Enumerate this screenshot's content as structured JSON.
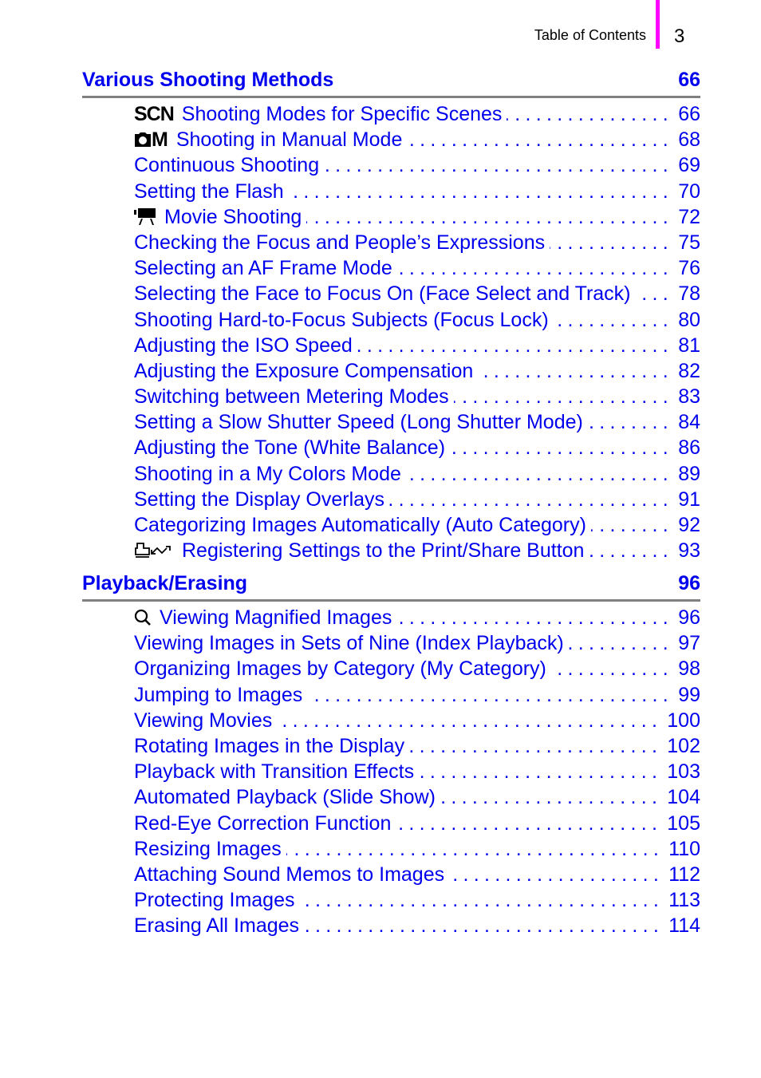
{
  "header": {
    "title": "Table of Contents",
    "page_number": "3",
    "accent_color": "#ff00ff"
  },
  "link_color": "#0000ee",
  "sections": [
    {
      "title": "Various Shooting Methods",
      "page": "66",
      "entries": [
        {
          "icon": "scn-mode-icon",
          "icon_text": "SCN",
          "title": "Shooting Modes for Specific Scenes",
          "page": "66"
        },
        {
          "icon": "camera-manual-icon",
          "icon_text": "M",
          "title": "Shooting in Manual Mode",
          "page": "68"
        },
        {
          "title": "Continuous Shooting",
          "page": "69"
        },
        {
          "title": "Setting the Flash",
          "page": "70"
        },
        {
          "icon": "movie-camera-icon",
          "title": "Movie Shooting",
          "page": "72"
        },
        {
          "title": "Checking the Focus and People’s Expressions",
          "page": "75"
        },
        {
          "title": "Selecting an AF Frame Mode",
          "page": "76"
        },
        {
          "title": "Selecting the Face to Focus On (Face Select and Track)",
          "page": "78"
        },
        {
          "title": "Shooting Hard-to-Focus Subjects (Focus Lock)",
          "page": "80"
        },
        {
          "title": "Adjusting the ISO Speed",
          "page": "81"
        },
        {
          "title": "Adjusting the Exposure Compensation",
          "page": "82"
        },
        {
          "title": "Switching between Metering Modes",
          "page": "83"
        },
        {
          "title": "Setting a Slow Shutter Speed (Long Shutter Mode)",
          "page": "84"
        },
        {
          "title": "Adjusting the Tone (White Balance)",
          "page": "86"
        },
        {
          "title": "Shooting in a My Colors Mode",
          "page": "89"
        },
        {
          "title": "Setting the Display Overlays",
          "page": "91"
        },
        {
          "title": "Categorizing Images Automatically (Auto Category)",
          "page": "92"
        },
        {
          "icon": "print-share-icon",
          "title": "Registering Settings to the Print/Share Button",
          "page": "93"
        }
      ]
    },
    {
      "title": "Playback/Erasing",
      "page": "96",
      "entries": [
        {
          "icon": "magnify-icon",
          "title": "Viewing Magnified Images",
          "page": "96"
        },
        {
          "title": "Viewing Images in Sets of Nine (Index Playback)",
          "page": "97"
        },
        {
          "title": "Organizing Images by Category (My Category)",
          "page": "98"
        },
        {
          "title": "Jumping to Images",
          "page": "99"
        },
        {
          "title": "Viewing Movies",
          "page": "100"
        },
        {
          "title": "Rotating Images in the Display",
          "page": "102"
        },
        {
          "title": "Playback with Transition Effects",
          "page": "103"
        },
        {
          "title": "Automated Playback (Slide Show)",
          "page": "104"
        },
        {
          "title": "Red-Eye Correction Function",
          "page": "105"
        },
        {
          "title": "Resizing Images",
          "page": "110"
        },
        {
          "title": "Attaching Sound Memos to Images",
          "page": "112"
        },
        {
          "title": "Protecting Images",
          "page": "113"
        },
        {
          "title": "Erasing All Images",
          "page": "114"
        }
      ]
    }
  ]
}
